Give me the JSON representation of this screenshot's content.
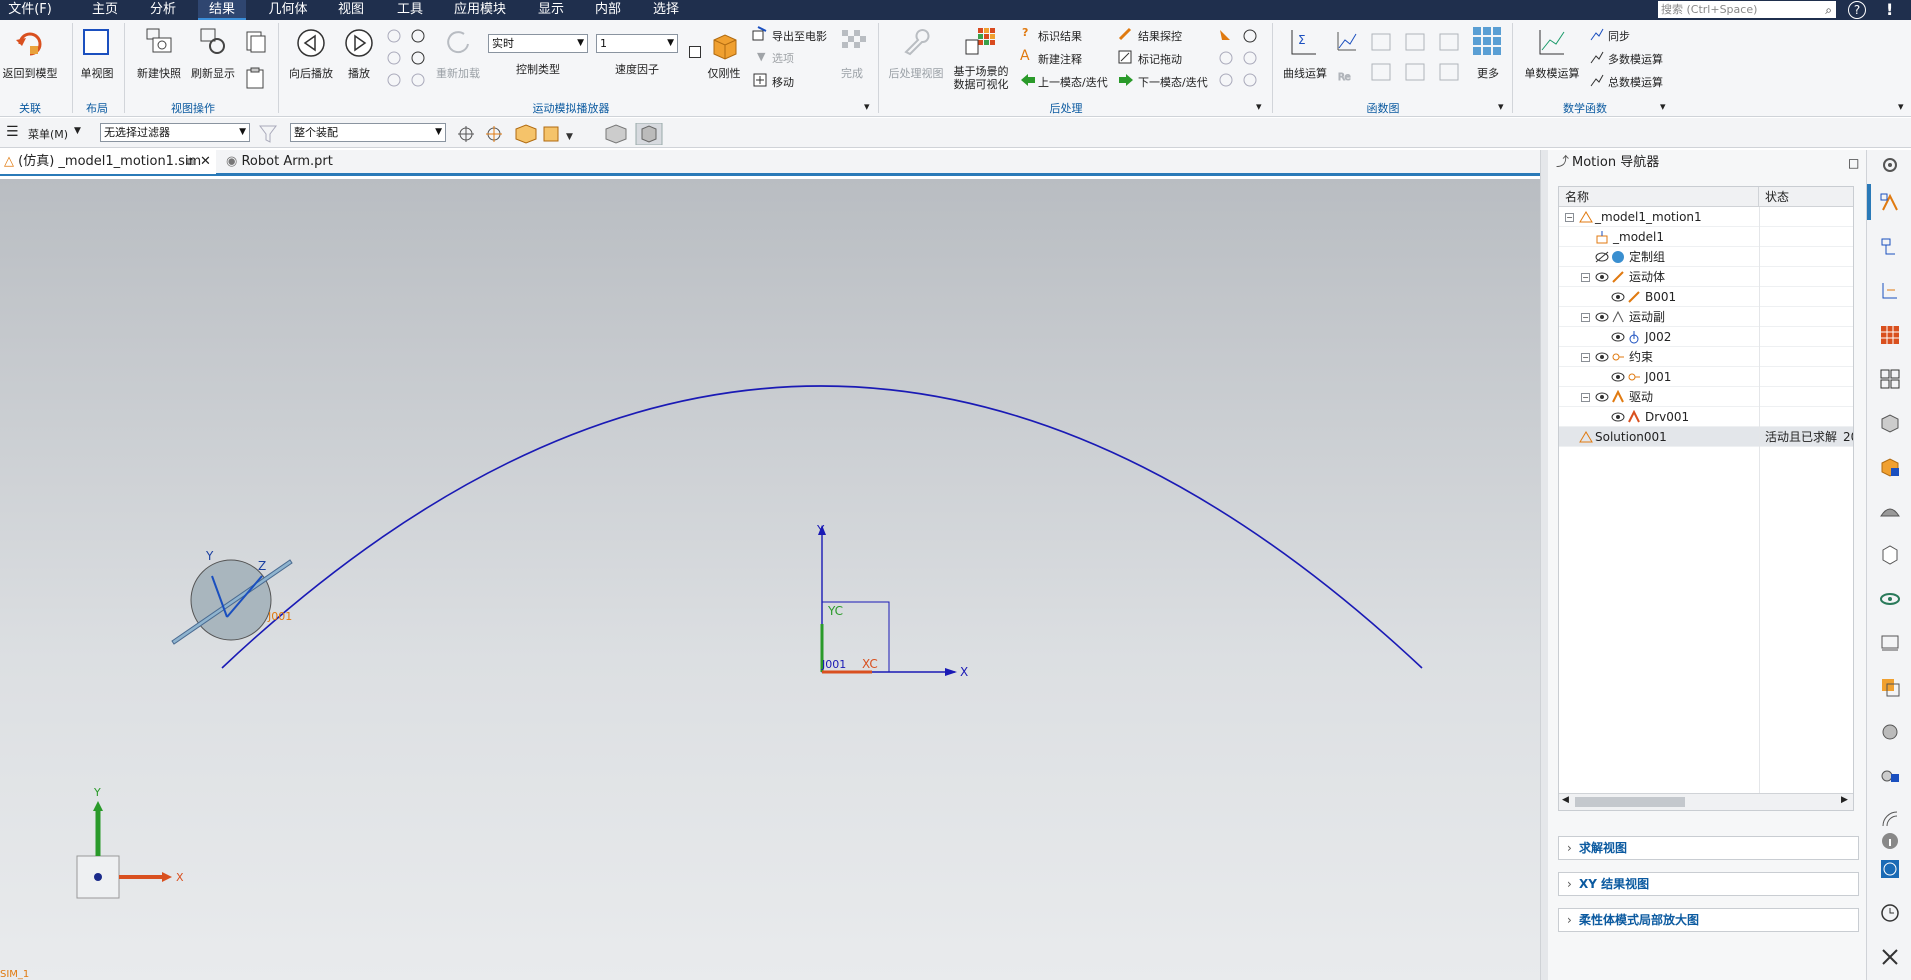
{
  "menu": [
    "文件(F)",
    "主页",
    "分析",
    "结果",
    "几何体",
    "视图",
    "工具",
    "应用模块",
    "显示",
    "内部",
    "选择"
  ],
  "active_menu": "结果",
  "search_placeholder": "搜索 (Ctrl+Space)",
  "ribbon": {
    "return_model": "返回到模型",
    "single_view": "单视图",
    "new_snapshot": "新建快照",
    "refresh_display": "刷新显示",
    "back_play": "向后播放",
    "play": "播放",
    "reload": "重新加载",
    "control_type_value": "实时",
    "control_type_label": "控制类型",
    "speed_value": "1",
    "speed_label": "速度因子",
    "rigid_only": "仅刚性",
    "export_movie": "导出至电影",
    "options": "选项",
    "move": "移动",
    "finish": "完成",
    "post_view": "后处理视图",
    "scene_viz": "基于场景的\n数据可视化",
    "mark_result": "标识结果",
    "result_probe": "结果探控",
    "new_note": "新建注释",
    "mark_trace": "标记拖动",
    "prev_mode": "上一模态/迭代",
    "next_mode": "下一模态/迭代",
    "curve_op": "曲线运算",
    "more": "更多",
    "single_math": "单数模运算",
    "sync": "同步",
    "multi_math": "多数模运算",
    "total_math": "总数模运算",
    "groups": {
      "related": "关联",
      "layout": "布局",
      "view_ops": "视图操作",
      "motion_player": "运动模拟播放器",
      "post": "后处理",
      "func_plot": "函数图",
      "math_func": "数学函数"
    }
  },
  "toolbar2": {
    "menu_label": "菜单(M)",
    "filter_value": "无选择过滤器",
    "scope_value": "整个装配"
  },
  "tabs": [
    {
      "label": "(仿真) _model1_motion1.sim"
    },
    {
      "label": "Robot Arm.prt"
    }
  ],
  "viewport": {
    "joint_label": "J001",
    "wcs_labels": {
      "yc": "YC",
      "xc": "XC",
      "x": "X",
      "y": "Y",
      "origin": "J001"
    },
    "body_axes": {
      "y": "Y",
      "z": "Z",
      "tag": "J001"
    },
    "triad": {
      "y": "Y",
      "x": "X"
    },
    "status": "SIM_1"
  },
  "navigator": {
    "title": "Motion 导航器",
    "columns": {
      "name": "名称",
      "status": "状态"
    },
    "rows": [
      {
        "name": "_model1_motion1",
        "status": ""
      },
      {
        "name": "_model1",
        "status": ""
      },
      {
        "name": "定制组",
        "status": ""
      },
      {
        "name": "运动体",
        "status": ""
      },
      {
        "name": "B001",
        "status": ""
      },
      {
        "name": "运动副",
        "status": ""
      },
      {
        "name": "J002",
        "status": ""
      },
      {
        "name": "约束",
        "status": ""
      },
      {
        "name": "J001",
        "status": ""
      },
      {
        "name": "驱动",
        "status": ""
      },
      {
        "name": "Drv001",
        "status": ""
      },
      {
        "name": "Solution001",
        "status": "活动且已求解",
        "extra": "20"
      }
    ],
    "panels": [
      "求解视图",
      "XY 结果视图",
      "柔性体模式局部放大图"
    ]
  },
  "colors": {
    "menubar": "#1f2f4d",
    "accent": "#2a7ab8",
    "curve": "#1a1ab5",
    "group_label": "#0b5aa0"
  }
}
